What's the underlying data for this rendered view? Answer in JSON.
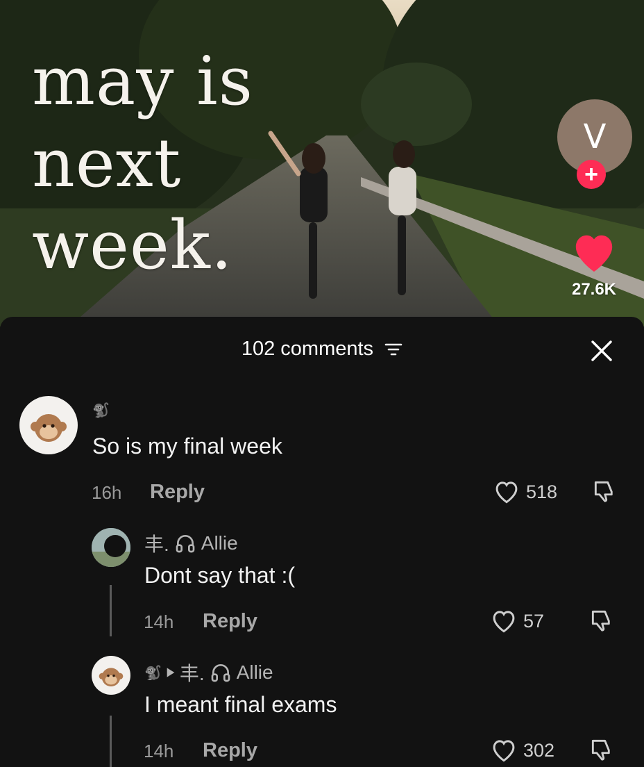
{
  "video": {
    "caption_lines": [
      "may is",
      "next",
      "week."
    ],
    "creator_initial": "V",
    "follow_symbol": "+",
    "like_count": "27.6K",
    "colors": {
      "like": "#fe2c55",
      "follow": "#fe2c55",
      "avatar_bg": "#8d7869"
    }
  },
  "comments_sheet": {
    "title": "102 comments",
    "close_icon": "close-icon",
    "filter_icon": "filter-icon"
  },
  "comments": [
    {
      "author_symbol": "🐒",
      "author_name": "",
      "text": "So is my final week",
      "time": "16h",
      "reply_label": "Reply",
      "likes": "518"
    },
    {
      "author_prefix": "丰.",
      "author_name": "Allie",
      "text": "Dont say that :(",
      "time": "14h",
      "reply_label": "Reply",
      "likes": "57"
    },
    {
      "author_symbol": "🐒",
      "reply_to_prefix": "丰.",
      "reply_to_name": "Allie",
      "text": "I meant final exams",
      "time": "14h",
      "reply_label": "Reply",
      "likes": "302"
    }
  ]
}
